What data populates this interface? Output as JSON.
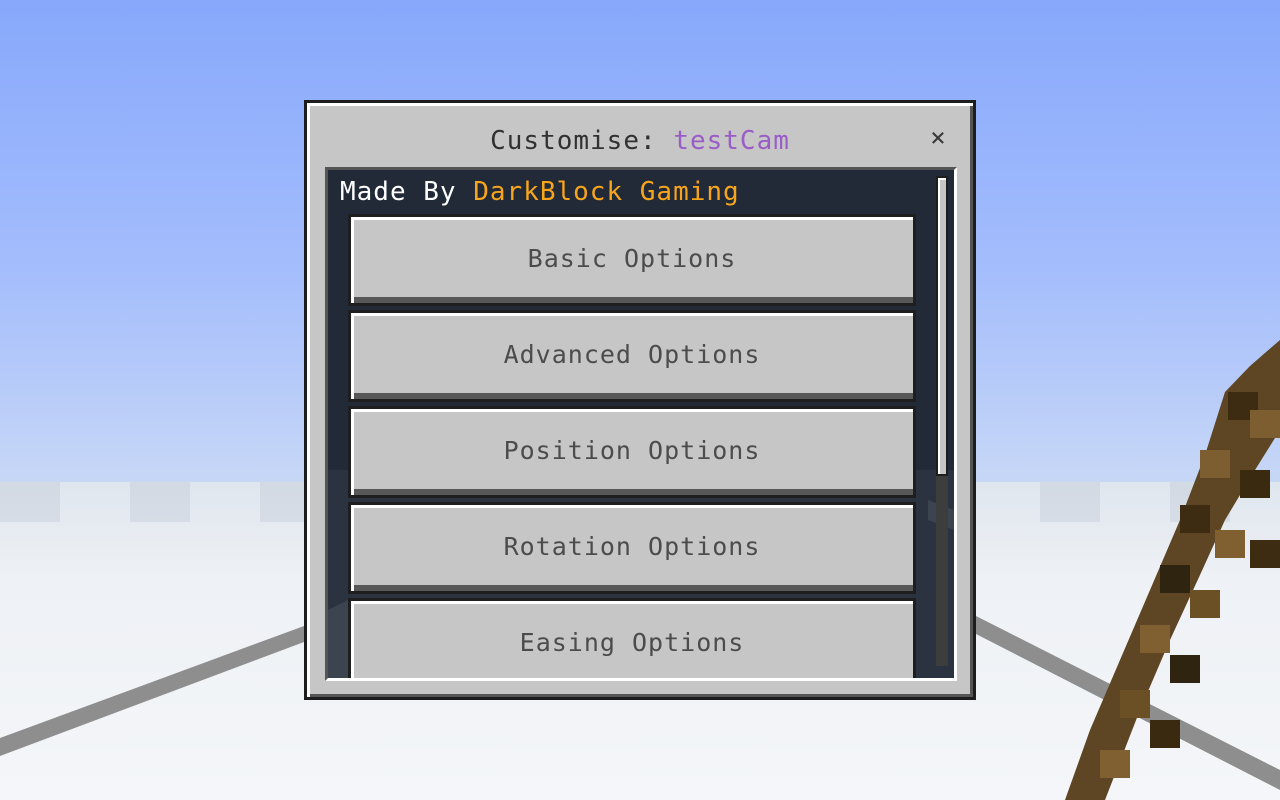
{
  "dialog": {
    "title_prefix": "Customise:",
    "title_name": "testCam",
    "close_label": "×"
  },
  "credit": {
    "prefix": "Made By",
    "author": "DarkBlock Gaming"
  },
  "options": [
    {
      "label": "Basic Options"
    },
    {
      "label": "Advanced Options"
    },
    {
      "label": "Position Options"
    },
    {
      "label": "Rotation Options"
    },
    {
      "label": "Easing Options"
    }
  ],
  "colors": {
    "title_name": "#9a5cc6",
    "author": "#f7a51c",
    "panel_bg": "#222a38",
    "button_bg": "#c6c6c6"
  }
}
